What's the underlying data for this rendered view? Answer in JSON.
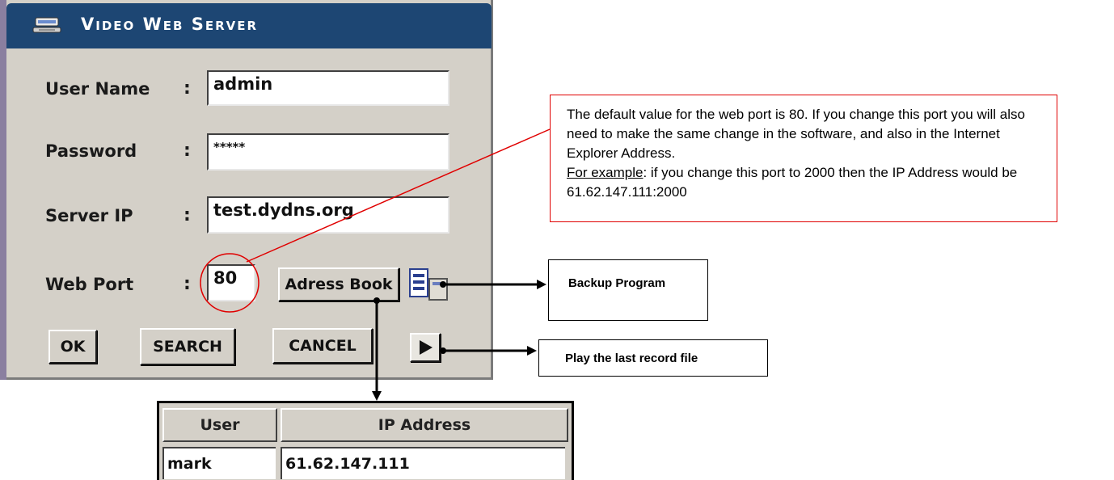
{
  "dialog": {
    "title": "Video Web Server",
    "labels": {
      "user_name": "User Name",
      "password": "Password",
      "server_ip": "Server IP",
      "web_port": "Web Port",
      "colon": ":"
    },
    "fields": {
      "user_name": "admin",
      "password": "*****",
      "server_ip": "test.dydns.org",
      "web_port": "80"
    },
    "buttons": {
      "address_book": "Adress Book",
      "ok": "OK",
      "search": "SEARCH",
      "cancel": "CANCEL"
    },
    "icons": [
      "network-server-icon",
      "backup-icon",
      "play-icon"
    ]
  },
  "annotations": {
    "web_port_note": {
      "text_1": "The default value for the web port is 80. If you change this port you will also need to make the same change in the software, and also in the Internet Explorer Address.",
      "example_label": "For example",
      "text_2": ": if you change this port to 2000 then the IP Address would be 61.62.147.111:2000"
    },
    "backup_program": "Backup Program",
    "play_last_record": "Play the last record file"
  },
  "address_table": {
    "headers": [
      "User",
      "IP Address"
    ],
    "rows": [
      [
        "mark",
        "61.62.147.111"
      ]
    ]
  },
  "colors": {
    "titlebar": "#1d4673",
    "dialog_face": "#d4d0c8",
    "callout": "#e00000"
  }
}
